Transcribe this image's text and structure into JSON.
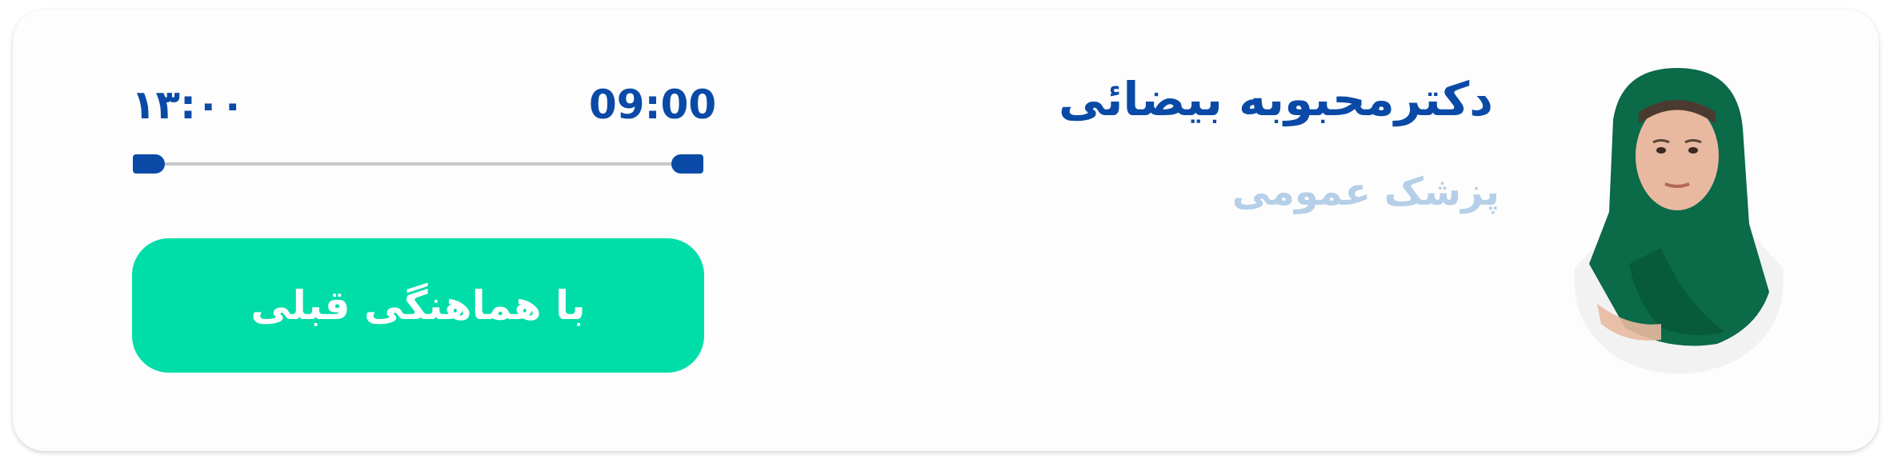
{
  "doctor": {
    "name": "دکترمحبوبه بیضائی",
    "specialty": "پزشک عمومی",
    "avatar_icon": "doctor-portrait"
  },
  "schedule": {
    "start_time": "09:00",
    "end_time": "۱۳:۰۰",
    "accent_color": "#0a4aa6",
    "track_color": "#c8c8c8"
  },
  "action": {
    "label": "با هماهنگی قبلی",
    "color": "#00dda8"
  }
}
